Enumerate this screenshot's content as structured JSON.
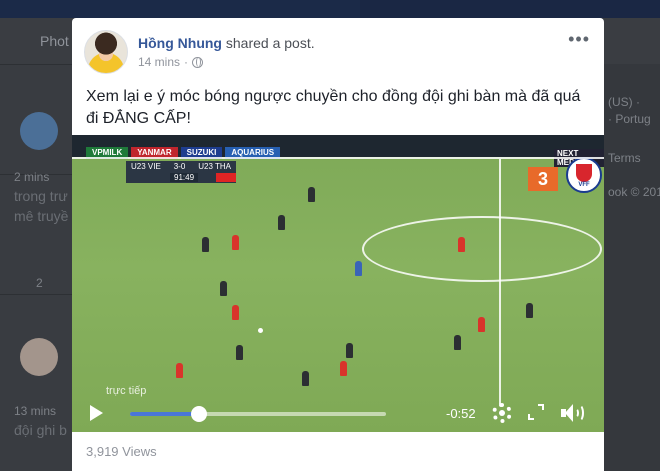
{
  "background": {
    "nav_label": "Phot",
    "left_times": [
      "2 mins",
      "13 mins"
    ],
    "left_texts": [
      "trong trư",
      "mê truyề",
      "đội ghi b"
    ],
    "left_count": "2",
    "right_texts": [
      "(US) ·",
      "· Portug",
      "Terms",
      "ook © 201"
    ]
  },
  "post": {
    "author": "Hồng Nhung",
    "action": "shared a post.",
    "time": "14 mins",
    "privacy_icon": "globe-icon",
    "more_label": "•••",
    "text": "Xem lại e ý móc bóng ngược chuyền cho đồng đội ghi bàn mà đã quá đi ĐẲNG CẤP!",
    "views": "3,919 Views"
  },
  "video": {
    "boards": [
      "VPMILK",
      "YANMAR",
      "SUZUKI",
      "AQUARIUS",
      "NEXT MEDIA"
    ],
    "score_home": "U23 VIE",
    "score": "3-0",
    "score_away": "U23 THA",
    "clock": "91:49",
    "corner_number": "3",
    "live_label": "trực tiếp",
    "time_remaining": "-0:52",
    "progress": 0.27,
    "colors": {
      "accent": "#4a76d8",
      "author": "#365899",
      "pitch": "#86b05d"
    }
  }
}
